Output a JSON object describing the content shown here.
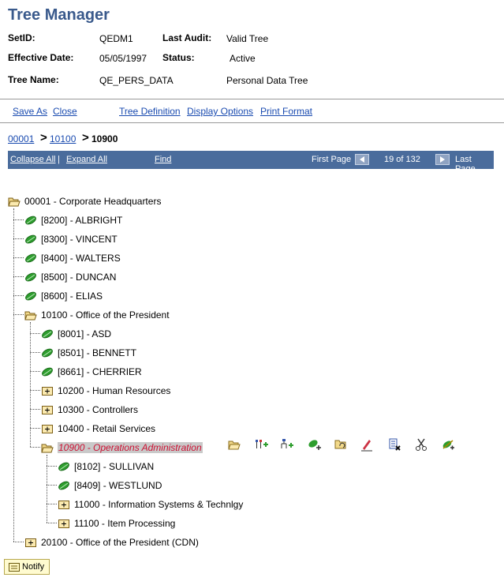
{
  "page": {
    "title": "Tree Manager"
  },
  "header": {
    "setid_label": "SetID:",
    "setid_value": "QEDM1",
    "last_audit_label": "Last Audit:",
    "last_audit_value": "Valid Tree",
    "effdt_label": "Effective Date:",
    "effdt_value": "05/05/1997",
    "status_label": "Status:",
    "status_value": "Active",
    "tree_name_label": "Tree Name:",
    "tree_name_value": "QE_PERS_DATA",
    "tree_desc": "Personal Data Tree"
  },
  "actions": {
    "save_as": "Save As",
    "close": "Close",
    "tree_definition": "Tree Definition",
    "display_options": "Display Options",
    "print_format": "Print Format"
  },
  "breadcrumb": {
    "items": [
      "00001",
      "10100"
    ],
    "current": "10900",
    "sep": ">"
  },
  "navbar": {
    "collapse_all": "Collapse All",
    "divider": "|",
    "expand_all": "Expand All",
    "find": "Find",
    "first_page": "First Page",
    "page_info": "19 of 132",
    "last_page": "Last Page"
  },
  "tree": {
    "nodes": [
      {
        "label": "00001 - Corporate Headquarters",
        "type": "folder-open"
      },
      {
        "label": "[8200] - ALBRIGHT",
        "type": "leaf"
      },
      {
        "label": "[8300] - VINCENT",
        "type": "leaf"
      },
      {
        "label": "[8400] - WALTERS",
        "type": "leaf"
      },
      {
        "label": "[8500] - DUNCAN",
        "type": "leaf"
      },
      {
        "label": "[8600] - ELIAS",
        "type": "leaf"
      },
      {
        "label": "10100 - Office of the President",
        "type": "folder-open"
      },
      {
        "label": "[8001] - ASD",
        "type": "leaf"
      },
      {
        "label": "[8501] - BENNETT",
        "type": "leaf"
      },
      {
        "label": "[8661] - CHERRIER",
        "type": "leaf"
      },
      {
        "label": "10200 - Human Resources",
        "type": "folder-closed"
      },
      {
        "label": "10300 - Controllers",
        "type": "folder-closed"
      },
      {
        "label": "10400 - Retail Services",
        "type": "folder-closed"
      },
      {
        "label": "10900 - Operations Administration",
        "type": "folder-open-selected"
      },
      {
        "label": "[8102] - SULLIVAN",
        "type": "leaf"
      },
      {
        "label": "[8409] - WESTLUND",
        "type": "leaf"
      },
      {
        "label": "11000 - Information Systems & Technlgy",
        "type": "folder-closed"
      },
      {
        "label": "11100 - Item Processing",
        "type": "folder-closed"
      },
      {
        "label": "20100 - Office of the President (CDN)",
        "type": "folder-closed"
      }
    ]
  },
  "toolbar": {
    "icons": [
      "folder-open-icon",
      "insert-sibling-icon",
      "insert-child-icon",
      "insert-leaf-icon",
      "move-node-icon",
      "edit-icon",
      "delete-icon",
      "cut-icon",
      "paste-icon"
    ]
  },
  "notify": {
    "label": "Notify"
  },
  "colors": {
    "navbar": "#4a6c9c",
    "title": "#3a5a8c",
    "link": "#1a4bb0",
    "leaf": "#2e9e2e",
    "selected_text": "#cc1133"
  }
}
